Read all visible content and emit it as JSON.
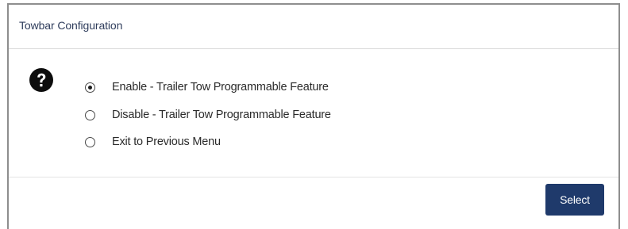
{
  "dialog": {
    "title": "Towbar Configuration",
    "help_icon": "question-circle-icon",
    "options": [
      {
        "label": "Enable - Trailer Tow Programmable Feature",
        "selected": true
      },
      {
        "label": "Disable - Trailer Tow Programmable Feature",
        "selected": false
      },
      {
        "label": "Exit to Previous Menu",
        "selected": false
      }
    ],
    "select_label": "Select"
  },
  "colors": {
    "title_text": "#2f3d5c",
    "button_bg": "#1f3a6b",
    "border": "#8e8e8e"
  }
}
